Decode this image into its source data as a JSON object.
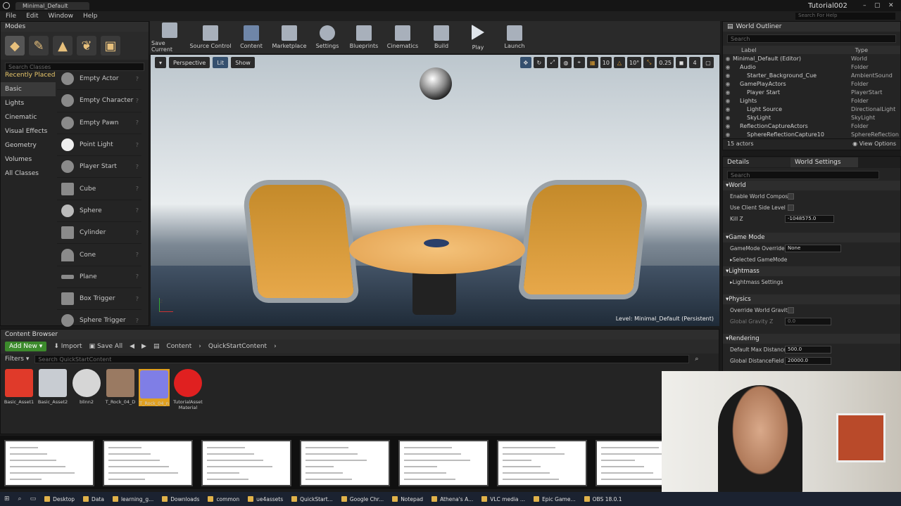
{
  "window": {
    "title": "Minimal_Default",
    "project": "Tutorial002",
    "search_help": "Search For Help"
  },
  "menu": [
    "File",
    "Edit",
    "Window",
    "Help"
  ],
  "modes": {
    "tab": "Modes",
    "search_placeholder": "Search Classes",
    "categories": [
      "Recently Placed",
      "Basic",
      "Lights",
      "Cinematic",
      "Visual Effects",
      "Geometry",
      "Volumes",
      "All Classes"
    ],
    "items": [
      "Empty Actor",
      "Empty Character",
      "Empty Pawn",
      "Point Light",
      "Player Start",
      "Cube",
      "Sphere",
      "Cylinder",
      "Cone",
      "Plane",
      "Box Trigger",
      "Sphere Trigger"
    ]
  },
  "toolbar": [
    "Save Current",
    "Source Control",
    "Content",
    "Marketplace",
    "Settings",
    "Blueprints",
    "Cinematics",
    "Build",
    "Play",
    "Launch"
  ],
  "viewport": {
    "perspective": "Perspective",
    "lit": "Lit",
    "show": "Show",
    "grid": "10",
    "angle": "10°",
    "scale": "0.25",
    "cam": "4",
    "level_label": "Level:",
    "level_name": "Minimal_Default (Persistent)"
  },
  "outliner": {
    "tab": "World Outliner",
    "search_placeholder": "Search",
    "col_label": "Label",
    "col_type": "Type",
    "rows": [
      {
        "label": "Minimal_Default (Editor)",
        "type": "World",
        "indent": 0
      },
      {
        "label": "Audio",
        "type": "Folder",
        "indent": 1
      },
      {
        "label": "Starter_Background_Cue",
        "type": "AmbientSound",
        "indent": 2
      },
      {
        "label": "GamePlayActors",
        "type": "Folder",
        "indent": 1
      },
      {
        "label": "Player Start",
        "type": "PlayerStart",
        "indent": 2
      },
      {
        "label": "Lights",
        "type": "Folder",
        "indent": 1
      },
      {
        "label": "Light Source",
        "type": "DirectionalLight",
        "indent": 2
      },
      {
        "label": "SkyLight",
        "type": "SkyLight",
        "indent": 2
      },
      {
        "label": "ReflectionCaptureActors",
        "type": "Folder",
        "indent": 1
      },
      {
        "label": "SphereReflectionCapture10",
        "type": "SphereReflection",
        "indent": 2
      }
    ],
    "count": "15 actors",
    "view_options": "View Options"
  },
  "details": {
    "tab1": "Details",
    "tab2": "World Settings",
    "search_placeholder": "Search",
    "sec_world": "World",
    "enable_world_compo": "Enable World Compos",
    "use_client_side": "Use Client Side Level",
    "kill_z": "Kill Z",
    "kill_z_val": "-1048575.0",
    "sec_gamemode": "Game Mode",
    "gamemode_override": "GameMode Override",
    "gamemode_val": "None",
    "selected_gamemode": "Selected GameMode",
    "sec_lightmass": "Lightmass",
    "lightmass_settings": "Lightmass Settings",
    "sec_physics": "Physics",
    "override_gravity": "Override World Gravit",
    "global_gravity": "Global Gravity Z",
    "global_gravity_val": "0.0",
    "sec_rendering": "Rendering",
    "default_max_distance": "Default Max Distance",
    "default_max_distance_val": "500.0",
    "global_distance_field": "Global DistanceField V",
    "global_distance_field_val": "20000.0"
  },
  "content_browser": {
    "tab": "Content Browser",
    "add_new": "Add New",
    "import": "Import",
    "save_all": "Save All",
    "crumb_root": "Content",
    "crumb_folder": "QuickStartContent",
    "filters": "Filters",
    "search_placeholder": "Search QuickStartContent",
    "assets": [
      {
        "name": "Basic_Asset1",
        "color": "#e03a2a"
      },
      {
        "name": "Basic_Asset2",
        "color": "#c8ccd2"
      },
      {
        "name": "blinn2",
        "color": "#d6d6d6"
      },
      {
        "name": "T_Rock_04_D",
        "color": "#9a7a62"
      },
      {
        "name": "T_Rock_04_n",
        "color": "#7f7ee6"
      },
      {
        "name": "TutorialAsset Material",
        "color": "#e02020"
      }
    ]
  },
  "taskbar": [
    "Desktop",
    "Data",
    "learning_g...",
    "Downloads",
    "common",
    "ue4assets",
    "QuickStart...",
    "Google Chr...",
    "Notepad",
    "Athena's A...",
    "VLC media ...",
    "Epic Game...",
    "OBS 18.0.1"
  ]
}
